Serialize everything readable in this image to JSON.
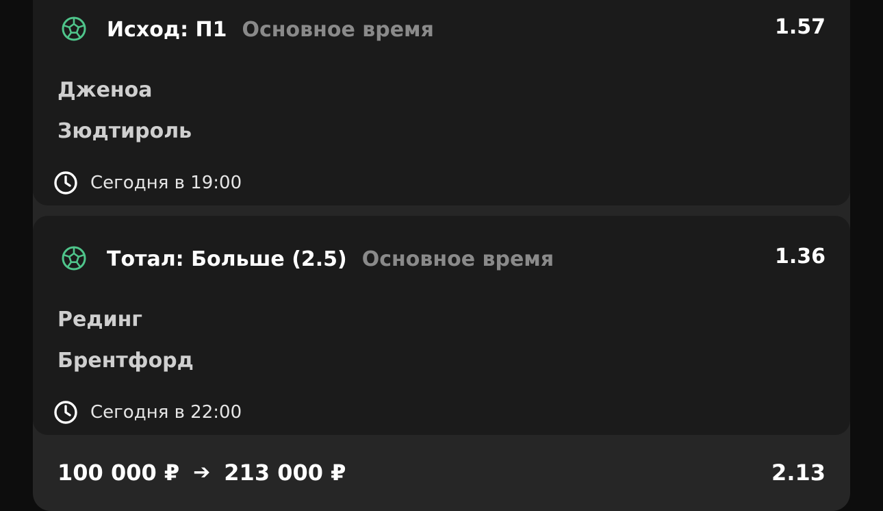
{
  "colors": {
    "background": "#0d0d0d",
    "panel": "#262626",
    "card": "#1b1b1b",
    "accent_green": "#4fc58b",
    "text_primary": "#ffffff",
    "text_secondary": "#8a8a8a",
    "team_text": "#cfcfcf"
  },
  "bets": [
    {
      "sport_icon": "soccer-ball-icon",
      "bet_name": "Исход: П1",
      "period": "Основное время",
      "odds": "1.57",
      "team_home": "Дженоа",
      "team_away": "Зюдтироль",
      "time_icon": "clock-icon",
      "time": "Сегодня в 19:00"
    },
    {
      "sport_icon": "soccer-ball-icon",
      "bet_name": "Тотал: Больше (2.5)",
      "period": "Основное время",
      "odds": "1.36",
      "team_home": "Рединг",
      "team_away": "Брентфорд",
      "time_icon": "clock-icon",
      "time": "Сегодня в 22:00"
    }
  ],
  "summary": {
    "stake": "100 000 ₽",
    "arrow": "➔",
    "payout": "213 000 ₽",
    "total_odds": "2.13"
  }
}
